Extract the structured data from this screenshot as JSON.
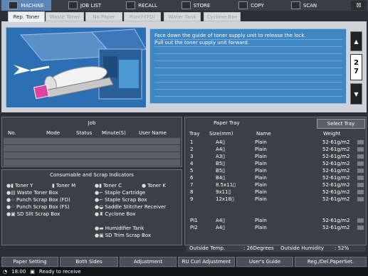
{
  "nav": {
    "tabs": [
      {
        "label": "MACHINE",
        "icon": "machine-icon"
      },
      {
        "label": "JOB LIST",
        "icon": "job-list-icon"
      },
      {
        "label": "RECALL",
        "icon": "recall-icon"
      },
      {
        "label": "STORE",
        "icon": "store-icon"
      },
      {
        "label": "COPY",
        "icon": "copy-icon"
      },
      {
        "label": "SCAN",
        "icon": "scan-icon"
      }
    ],
    "close_glyph": "⊠"
  },
  "subtabs": [
    "Rep. Toner",
    "Waste Toner",
    "No Paper",
    "Punch(FD)",
    "Water Tank",
    "Cyclone Box"
  ],
  "message": {
    "line1": "Face down the guide of toner supply unit to release the lock.",
    "line2": "Pull out the toner supply unit forward."
  },
  "pager": {
    "current": "2",
    "total": "7",
    "up": "▲",
    "down": "▼"
  },
  "job": {
    "title": "Job",
    "columns": [
      "No.",
      "Mode",
      "Status",
      "Minute(S)",
      "User Name"
    ]
  },
  "consumables": {
    "title": "Consumable and Scrap Indicators",
    "left": [
      {
        "label": "Toner Y"
      },
      {
        "label": "Waste Toner Box"
      },
      {
        "label": "Punch Scrap Box (FD)"
      },
      {
        "label": "Punch Scrap Box (FS)"
      },
      {
        "label": "SD Slit Scrap Box"
      }
    ],
    "toner_m": "Toner M",
    "right": [
      {
        "label": "Toner C"
      },
      {
        "label": "Staple Cartridge"
      },
      {
        "label": "Staple Scrap Box"
      },
      {
        "label": "Saddle Stitcher Receiver"
      },
      {
        "label": "Cyclone Box"
      }
    ],
    "toner_k": "Toner K",
    "extra": [
      {
        "label": "Humidifier Tank"
      },
      {
        "label": "SD Trim Scrap Box"
      }
    ]
  },
  "paper_tray": {
    "title": "Paper Tray",
    "select_button": "Select Tray",
    "columns": [
      "Tray",
      "Size(mm)",
      "Name",
      "Weight"
    ],
    "rows": [
      {
        "tray": "1",
        "size": "A4▯",
        "name": "Plain",
        "weight": "52-61g/m2"
      },
      {
        "tray": "2",
        "size": "A4▯",
        "name": "Plain",
        "weight": "52-61g/m2"
      },
      {
        "tray": "3",
        "size": "A3▯",
        "name": "Plain",
        "weight": "52-61g/m2"
      },
      {
        "tray": "4",
        "size": "B5▯",
        "name": "Plain",
        "weight": "52-61g/m2"
      },
      {
        "tray": "5",
        "size": "B5▯",
        "name": "Plain",
        "weight": "52-61g/m2"
      },
      {
        "tray": "6",
        "size": "B4▯",
        "name": "Plain",
        "weight": "52-61g/m2"
      },
      {
        "tray": "7",
        "size": "8.5x11▯",
        "name": "Plain",
        "weight": "52-61g/m2"
      },
      {
        "tray": "8",
        "size": "9x11▯",
        "name": "Plain",
        "weight": "52-61g/m2"
      },
      {
        "tray": "9",
        "size": "12x18▯",
        "name": "Plain",
        "weight": "52-61g/m2"
      }
    ],
    "pi_rows": [
      {
        "tray": "PI1",
        "size": "A4▯",
        "name": "Plain",
        "weight": "52-61g/m2"
      },
      {
        "tray": "PI2",
        "size": "A4▯",
        "name": "Plain",
        "weight": "52-61g/m2"
      }
    ],
    "outside_temp_label": "Outside Temp.",
    "outside_temp_value": ": 26Degrees",
    "outside_humidity_label": "Outside Humidity",
    "outside_humidity_value": ": 52%"
  },
  "bottom": {
    "buttons": [
      "Paper Setting",
      "Both Sides",
      "Adjustment",
      "RU Curl Adjustment",
      "User's Guide",
      "Reg./Del.PaperSet."
    ]
  },
  "status": {
    "time": "18:00",
    "text": "Ready to receive"
  },
  "colors": {
    "accent": "#5d86b8",
    "message_bg": "#3f86c3",
    "panel_bg": "#3b3f47"
  }
}
